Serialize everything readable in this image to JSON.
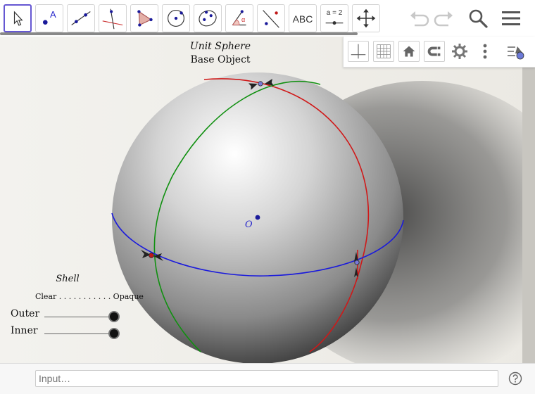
{
  "toolbar": {
    "tools": [
      {
        "name": "move-tool",
        "label": ""
      },
      {
        "name": "point-tool",
        "label": "A"
      },
      {
        "name": "line-tool",
        "label": ""
      },
      {
        "name": "perpendicular-line-tool",
        "label": ""
      },
      {
        "name": "polygon-tool",
        "label": ""
      },
      {
        "name": "circle-tool",
        "label": ""
      },
      {
        "name": "conic-tool",
        "label": ""
      },
      {
        "name": "angle-tool",
        "label": "α"
      },
      {
        "name": "reflect-tool",
        "label": ""
      },
      {
        "name": "text-tool",
        "label": "ABC"
      },
      {
        "name": "slider-tool",
        "label": "a = 2"
      },
      {
        "name": "move-graphics-tool",
        "label": ""
      }
    ],
    "undo_icon": "undo-icon",
    "redo_icon": "redo-icon",
    "search_icon": "search-icon",
    "menu_icon": "menu-icon"
  },
  "style_bar": {
    "buttons": [
      "axes-icon",
      "grid-icon",
      "home-icon",
      "point-capture-icon",
      "settings-icon",
      "more-vert-icon",
      "view-toggle-icon"
    ]
  },
  "graphics": {
    "title_line1": "Unit Sphere",
    "title_line2": "Base Object",
    "origin_label": "O",
    "shell": {
      "label": "Shell",
      "scale": "Clear . . . . . . . . . . . Opaque",
      "outer_label": "Outer",
      "inner_label": "Inner",
      "outer_value": 1.0,
      "inner_value": 1.0
    },
    "colors": {
      "equator": "#1a1adc",
      "meridian_red": "#d01818",
      "meridian_green": "#109010",
      "origin_point": "#1a1a9a",
      "red_point": "#c01818",
      "blue_point": "#7a7ad8"
    }
  },
  "input_bar": {
    "placeholder": "Input…",
    "help_icon": "help-icon"
  }
}
